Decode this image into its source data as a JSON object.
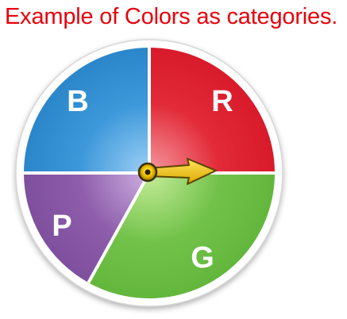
{
  "title": "Example of Colors as categories.",
  "title_color": "#e8000b",
  "spinner": {
    "segments": [
      {
        "label": "B",
        "color": "#2f8fd4",
        "highlight": "#9ed0f5"
      },
      {
        "label": "R",
        "color": "#e0202f",
        "highlight": "#f59aa0"
      },
      {
        "label": "G",
        "color": "#6cbe45",
        "highlight": "#c5ec98"
      },
      {
        "label": "P",
        "color": "#8a5aa8",
        "highlight": "#cdb0e0"
      }
    ],
    "pointer": {
      "color": "#f2c400",
      "direction": "right"
    }
  }
}
